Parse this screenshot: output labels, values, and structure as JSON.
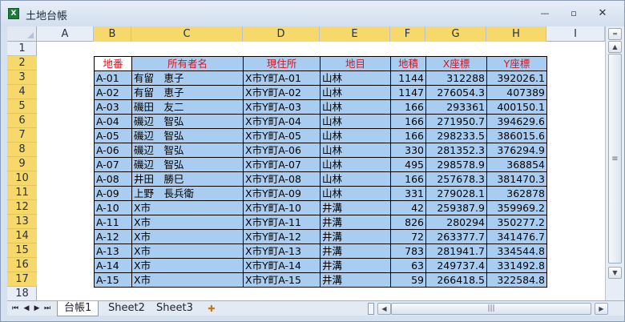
{
  "window": {
    "title": "土地台帳",
    "app_icon": "X"
  },
  "columns": [
    "A",
    "B",
    "C",
    "D",
    "E",
    "F",
    "G",
    "H",
    "I"
  ],
  "rows": [
    "1",
    "2",
    "3",
    "4",
    "5",
    "6",
    "7",
    "8",
    "9",
    "10",
    "11",
    "12",
    "13",
    "14",
    "15",
    "16",
    "17",
    "18"
  ],
  "table": {
    "headers": [
      "地番",
      "所有者名",
      "現住所",
      "地目",
      "地積",
      "X座標",
      "Y座標"
    ],
    "rows": [
      [
        "A-01",
        "有留　恵子",
        "X市Y町A-01",
        "山林",
        "1144",
        "312288",
        "392026.1"
      ],
      [
        "A-02",
        "有留　恵子",
        "X市Y町A-02",
        "山林",
        "1147",
        "276054.3",
        "407389"
      ],
      [
        "A-03",
        "磯田　友二",
        "X市Y町A-03",
        "山林",
        "166",
        "293361",
        "400150.1"
      ],
      [
        "A-04",
        "磯辺　智弘",
        "X市Y町A-04",
        "山林",
        "166",
        "271950.7",
        "394629.6"
      ],
      [
        "A-05",
        "磯辺　智弘",
        "X市Y町A-05",
        "山林",
        "166",
        "298233.5",
        "386015.6"
      ],
      [
        "A-06",
        "磯辺　智弘",
        "X市Y町A-06",
        "山林",
        "330",
        "281352.3",
        "376294.9"
      ],
      [
        "A-07",
        "磯辺　智弘",
        "X市Y町A-07",
        "山林",
        "495",
        "298578.9",
        "368854"
      ],
      [
        "A-08",
        "井田　勝巳",
        "X市Y町A-08",
        "山林",
        "166",
        "257678.3",
        "381470.3"
      ],
      [
        "A-09",
        "上野　長兵衛",
        "X市Y町A-09",
        "山林",
        "331",
        "279028.1",
        "362878"
      ],
      [
        "A-10",
        "X市",
        "X市Y町A-10",
        "井溝",
        "42",
        "259387.9",
        "359969.2"
      ],
      [
        "A-11",
        "X市",
        "X市Y町A-11",
        "井溝",
        "826",
        "280294",
        "350277.2"
      ],
      [
        "A-12",
        "X市",
        "X市Y町A-12",
        "井溝",
        "72",
        "263377.7",
        "341476.7"
      ],
      [
        "A-13",
        "X市",
        "X市Y町A-13",
        "井溝",
        "783",
        "281941.7",
        "334544.8"
      ],
      [
        "A-14",
        "X市",
        "X市Y町A-14",
        "井溝",
        "63",
        "249737.4",
        "331492.8"
      ],
      [
        "A-15",
        "X市",
        "X市Y町A-15",
        "井溝",
        "59",
        "266418.5",
        "322584.8"
      ]
    ]
  },
  "sheets": [
    "台帳1",
    "Sheet2",
    "Sheet3"
  ],
  "colors": {
    "cell_fill": "#a9cdf0",
    "header_text": "#d4141e",
    "selected_header": "#f7d86b"
  }
}
